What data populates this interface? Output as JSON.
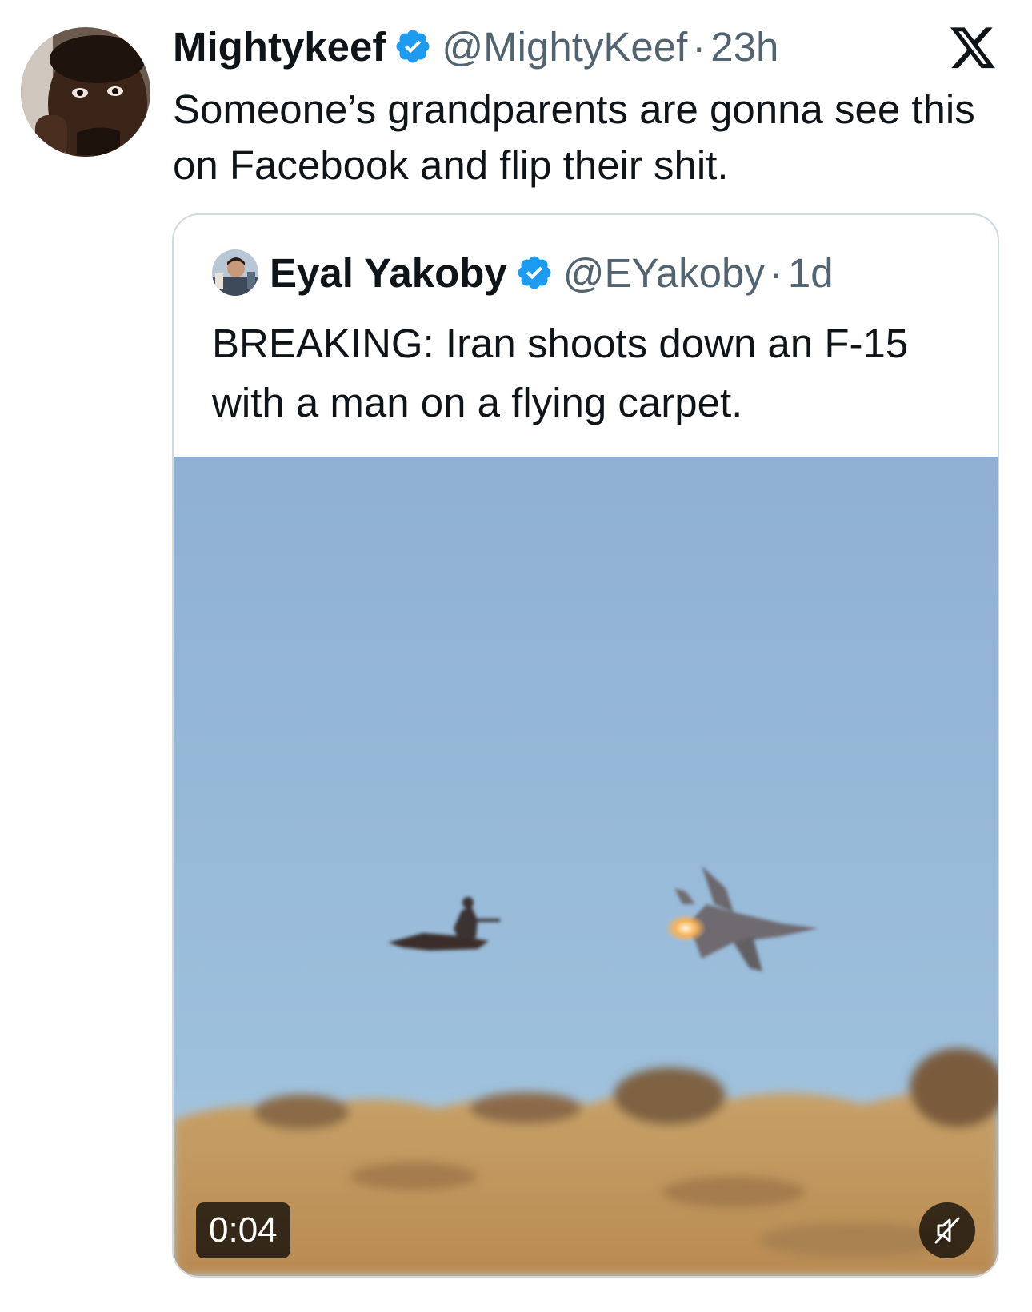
{
  "tweet": {
    "display_name": "Mightykeef",
    "handle": "@MightyKeef",
    "separator": "·",
    "time": "23h",
    "text": "Someone’s grandparents are gonna see this on Facebook and flip their shit.",
    "verified": true
  },
  "quote": {
    "display_name": "Eyal Yakoby",
    "handle": "@EYakoby",
    "separator": "·",
    "time": "1d",
    "text": "BREAKING: Iran shoots down an F-15 with a man on a flying carpet.",
    "verified": true,
    "media": {
      "type": "video",
      "duration": "0:04",
      "muted": true
    }
  },
  "colors": {
    "text": "#0f1419",
    "secondary": "#536471",
    "verified_badge": "#1d9bf0",
    "border": "#cfd9de",
    "sky": "#8db3d6",
    "desert": "#c49a5e"
  },
  "icons": {
    "verified": "verified-badge-icon",
    "platform": "x-logo-icon",
    "mute": "muted-speaker-icon"
  }
}
